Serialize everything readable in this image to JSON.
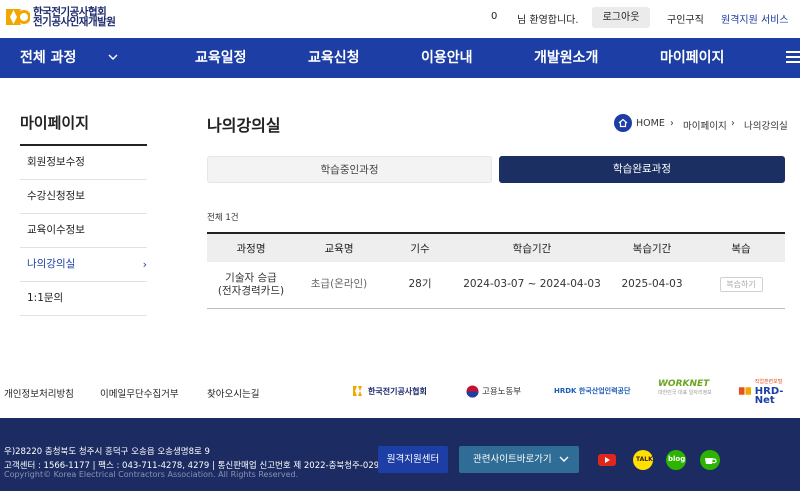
{
  "header": {
    "logo_line1": "한국전기공사협회",
    "logo_line2": "전기공사인재개발원",
    "user_count": "0",
    "welcome": "님 환영합니다.",
    "logout": "로그아웃",
    "jobs": "구인구직",
    "remote_service": "원격지원 서비스"
  },
  "nav": {
    "all_courses": "전체 과정",
    "items": [
      "교육일정",
      "교육신청",
      "이용안내",
      "개발원소개",
      "마이페이지"
    ]
  },
  "sidebar": {
    "title": "마이페이지",
    "items": [
      {
        "label": "회원정보수정"
      },
      {
        "label": "수강신청정보"
      },
      {
        "label": "교육이수정보"
      },
      {
        "label": "나의강의실",
        "arrow": "›"
      },
      {
        "label": "1:1문의"
      }
    ]
  },
  "main": {
    "title": "나의강의실",
    "breadcrumb": [
      "HOME",
      "마이페이지",
      "나의강의실"
    ],
    "breadcrumb_sep": "›",
    "tabs": [
      "학습중인과정",
      "학습완료과정"
    ],
    "total": "전체 1건",
    "table": {
      "headers": [
        "과정명",
        "교육명",
        "기수",
        "학습기간",
        "복습기간",
        "복습"
      ],
      "rows": [
        {
          "course_line1": "기술자 승급",
          "course_line2": "(전자경력카드)",
          "level": "초급(온라인)",
          "term": "28기",
          "study_period": "2024-03-07 ~ 2024-04-03",
          "review_period": "2025-04-03",
          "review_btn": "복습하기"
        }
      ]
    }
  },
  "footer_links": [
    "개인정보처리방침",
    "이메일무단수집거부",
    "찾아오시는길"
  ],
  "partners": [
    "한국전기공사협회",
    "고용노동부",
    "HRDK 한국산업인력공단",
    "WORKNET",
    "HRD-Net"
  ],
  "partners_sub": {
    "worknet": "대한민국 대표 일자리정보",
    "hrdnet": "직업훈련포털"
  },
  "footer": {
    "address": "우)28220 충청북도 청주시 흥덕구 오송읍 오송생명8로 9",
    "contact": "고객센터 : 1566-1177   |   팩스 : 043-711-4278, 4279   |   통신판매업 신고번호 제 2022-충북청주-0295호",
    "copyright": "Copyright© Korea Electrical Contractors Association. All Rights Reserved.",
    "btn_remote": "원격지원센터",
    "btn_sites": "관련사이트바로가기",
    "kakao": "TALK",
    "blog": "blog"
  },
  "colors": {
    "primary": "#1c3ea5",
    "dark_navy": "#1b2f62",
    "footer": "#1c2c62",
    "sites_btn": "#2f6c96"
  }
}
